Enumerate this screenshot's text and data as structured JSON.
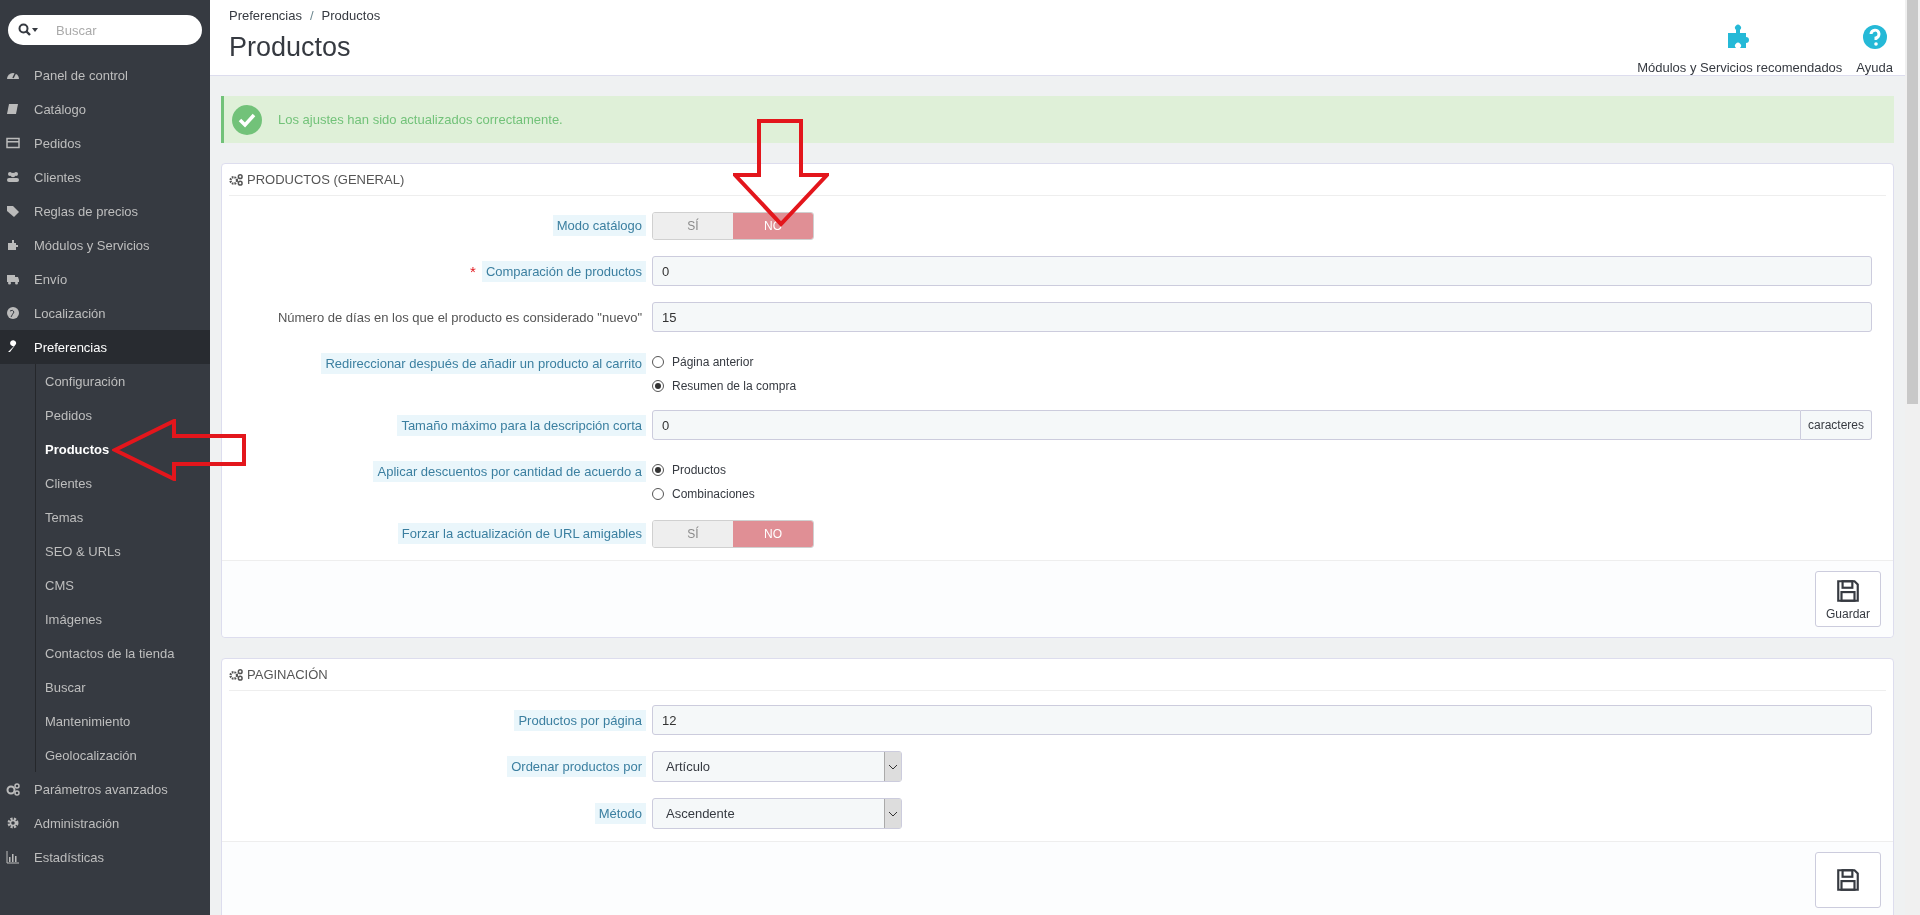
{
  "sidebar": {
    "search": {
      "placeholder": "Buscar"
    },
    "items": [
      {
        "label": "Panel de control",
        "selected": false
      },
      {
        "label": "Catálogo",
        "selected": false
      },
      {
        "label": "Pedidos",
        "selected": false
      },
      {
        "label": "Clientes",
        "selected": false
      },
      {
        "label": "Reglas de precios",
        "selected": false
      },
      {
        "label": "Módulos y Servicios",
        "selected": false
      },
      {
        "label": "Envío",
        "selected": false
      },
      {
        "label": "Localización",
        "selected": false
      },
      {
        "label": "Preferencias",
        "selected": true,
        "expanded": true,
        "children": [
          {
            "label": "Configuración",
            "selected": false
          },
          {
            "label": "Pedidos",
            "selected": false
          },
          {
            "label": "Productos",
            "selected": true
          },
          {
            "label": "Clientes",
            "selected": false
          },
          {
            "label": "Temas",
            "selected": false
          },
          {
            "label": "SEO & URLs",
            "selected": false
          },
          {
            "label": "CMS",
            "selected": false
          },
          {
            "label": "Imágenes",
            "selected": false
          },
          {
            "label": "Contactos de la tienda",
            "selected": false
          },
          {
            "label": "Buscar",
            "selected": false
          },
          {
            "label": "Mantenimiento",
            "selected": false
          },
          {
            "label": "Geolocalización",
            "selected": false
          }
        ]
      },
      {
        "label": "Parámetros avanzados",
        "selected": false
      },
      {
        "label": "Administración",
        "selected": false
      },
      {
        "label": "Estadísticas",
        "selected": false
      }
    ]
  },
  "header": {
    "breadcrumb": [
      "Preferencias",
      "/",
      "Productos"
    ],
    "title": "Productos",
    "toolbar": [
      {
        "label": "Módulos y Servicios recomendados"
      },
      {
        "label": "Ayuda"
      }
    ]
  },
  "alert": {
    "kind": "success",
    "text": "Los ajustes han sido actualizados correctamente."
  },
  "panels": [
    {
      "title": "PRODUCTOS (GENERAL)",
      "save_label": "Guardar",
      "fields": [
        {
          "kind": "switch",
          "label": "Modo catálogo",
          "help": true,
          "options": [
            {
              "label": "SÍ",
              "selected": false
            },
            {
              "label": "NO",
              "selected": true
            }
          ]
        },
        {
          "kind": "text",
          "label": "Comparación de productos",
          "help": true,
          "required_mark": "*",
          "value": "0"
        },
        {
          "kind": "text",
          "label": "Número de días en los que el producto es considerado \"nuevo\"",
          "help": false,
          "value": "15"
        },
        {
          "kind": "radio",
          "label": "Redireccionar después de añadir un producto al carrito",
          "help": true,
          "options": [
            {
              "label": "Página anterior",
              "selected": false
            },
            {
              "label": "Resumen de la compra",
              "selected": true
            }
          ]
        },
        {
          "kind": "addon",
          "label": "Tamaño máximo para la descripción corta",
          "help": true,
          "value": "0",
          "addon": "caracteres"
        },
        {
          "kind": "radio",
          "label": "Aplicar descuentos por cantidad de acuerdo a",
          "help": true,
          "options": [
            {
              "label": "Productos",
              "selected": true
            },
            {
              "label": "Combinaciones",
              "selected": false
            }
          ]
        },
        {
          "kind": "switch",
          "label": "Forzar la actualización de URL amigables",
          "help": true,
          "options": [
            {
              "label": "SÍ",
              "selected": false
            },
            {
              "label": "NO",
              "selected": true
            }
          ]
        }
      ]
    },
    {
      "title": "PAGINACIÓN",
      "fields": [
        {
          "kind": "text",
          "label": "Productos por página",
          "help": true,
          "value": "12"
        },
        {
          "kind": "select",
          "label": "Ordenar productos por",
          "help": true,
          "value": "Artículo"
        },
        {
          "kind": "select",
          "label": "Método",
          "help": true,
          "value": "Ascendente"
        }
      ]
    }
  ]
}
